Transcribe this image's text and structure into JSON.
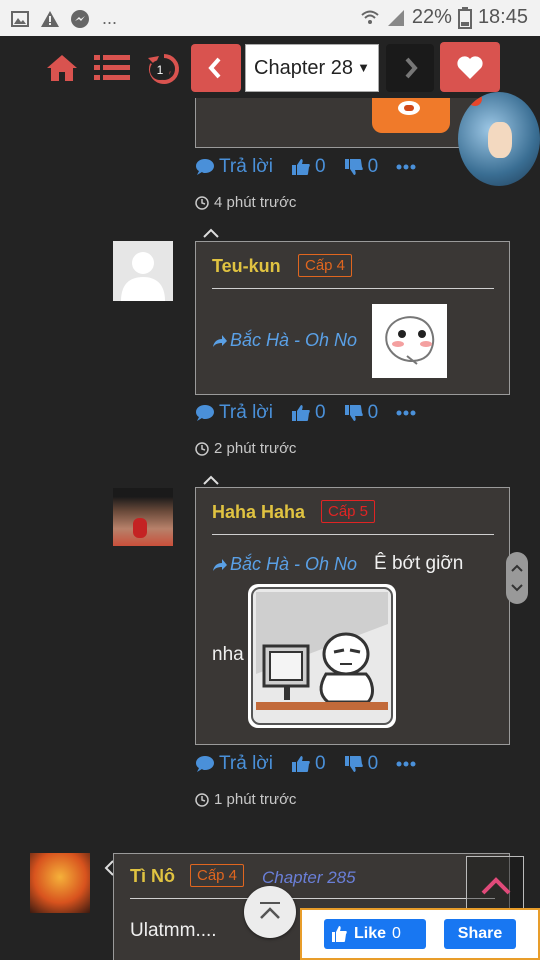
{
  "status_bar": {
    "battery": "22%",
    "time": "18:45",
    "overflow": "..."
  },
  "nav": {
    "history_badge": "1",
    "chapter_select": "Chapter 28"
  },
  "comments": [
    {
      "reply_label": "Trả lời",
      "likes": "0",
      "dislikes": "0",
      "time": "4 phút trước"
    },
    {
      "user": "Teu-kun",
      "level": "Cấp 4",
      "level_color": "#e0661f",
      "reply_to": "Bắc Hà - Oh No",
      "reply_label": "Trả lời",
      "likes": "0",
      "dislikes": "0",
      "time": "2 phút trước"
    },
    {
      "user": "Haha Haha",
      "level": "Cấp 5",
      "level_color": "#e02424",
      "reply_to": "Bắc Hà - Oh No",
      "text_1": "Ê bớt giỡn",
      "text_2": "nha",
      "reply_label": "Trả lời",
      "likes": "0",
      "dislikes": "0",
      "time": "1 phút trước"
    },
    {
      "user": "Tì Nô",
      "level": "Cấp 4",
      "level_color": "#e0661f",
      "chapter": "Chapter 285",
      "text": "Ulatmm...."
    }
  ],
  "facebook": {
    "like_label": "Like",
    "like_count": "0",
    "share_label": "Share"
  },
  "colors": {
    "accent_red": "#d9534f",
    "link_blue": "#4a90d9",
    "username_yellow": "#e0c341"
  }
}
